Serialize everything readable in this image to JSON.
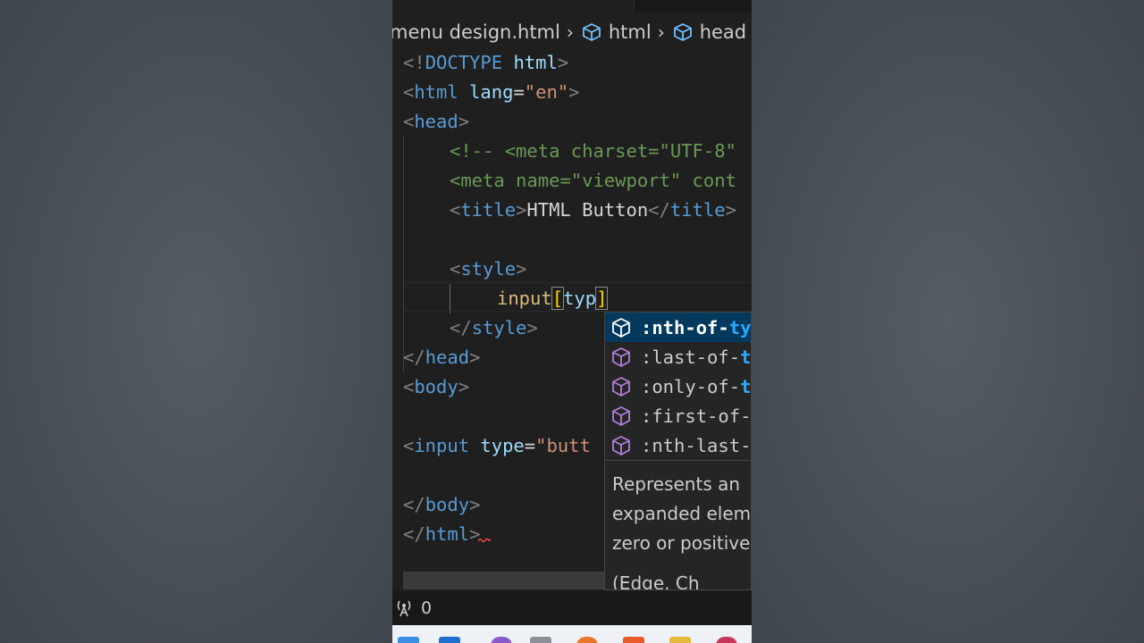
{
  "colors": {
    "editor_bg": "#1f1f1f",
    "selected_bg": "#04395e",
    "match_blue": "#2aaaff",
    "tag_blue": "#569cd6",
    "attr_blue": "#9cdcfe",
    "string_orange": "#ce9178",
    "comment_green": "#6a9955",
    "selector_gold": "#d7ba7d",
    "icon_purple": "#b180d7"
  },
  "breadcrumb": {
    "file": "menu design.html",
    "items": [
      "html",
      "head"
    ]
  },
  "code": {
    "l1": {
      "open": "<!",
      "kw": "DOCTYPE",
      "name": "html",
      "close": ">"
    },
    "l2": {
      "open": "<",
      "tag": "html",
      "attr": "lang",
      "eq": "=",
      "val": "\"en\"",
      "close": ">"
    },
    "l3": {
      "open": "<",
      "tag": "head",
      "close": ">"
    },
    "l4": {
      "comment": "<!-- <meta charset=\"UTF-8\""
    },
    "l5": {
      "text": "<meta name=\"viewport\" cont"
    },
    "l6": {
      "open": "<",
      "tag": "title",
      "close": ">",
      "text": "HTML Button",
      "open2": "</",
      "tag2": "title",
      "close2": ">"
    },
    "l8": {
      "open": "<",
      "tag": "style",
      "close": ">"
    },
    "l9": {
      "selector": "input",
      "bracket_open": "[",
      "attr": "typ",
      "bracket_close": "]"
    },
    "l10": {
      "open": "</",
      "tag": "style",
      "close": ">"
    },
    "l11": {
      "open": "</",
      "tag": "head",
      "close": ">"
    },
    "l12": {
      "open": "<",
      "tag": "body",
      "close": ">"
    },
    "l14": {
      "open": "<",
      "tag": "input",
      "attr": "type",
      "eq": "=",
      "val": "\"butt"
    },
    "l16": {
      "open": "</",
      "tag": "body",
      "close": ">"
    },
    "l17": {
      "open": "</",
      "tag": "html",
      "close": ">"
    }
  },
  "suggestions": [
    {
      "label_match": ":nth-of-",
      "label_rest": "ty",
      "icon": "cube-icon",
      "selected": true
    },
    {
      "label_match": ":last-of-",
      "label_rest": "t",
      "icon": "cube-icon",
      "selected": false
    },
    {
      "label_match": ":only-of-",
      "label_rest": "t",
      "icon": "cube-icon",
      "selected": false
    },
    {
      "label_match": ":first-of-",
      "label_rest": "",
      "icon": "cube-icon",
      "selected": false
    },
    {
      "label_match": ":nth-last-",
      "label_rest": "",
      "icon": "cube-icon",
      "selected": false
    }
  ],
  "suggestion_doc": {
    "line1": "Represents an",
    "line2": "expanded elem",
    "line3": "zero or positive",
    "line4": "(Edge, Ch"
  },
  "status": {
    "ports_icon": "broadcast-icon",
    "ports_count": "0"
  }
}
